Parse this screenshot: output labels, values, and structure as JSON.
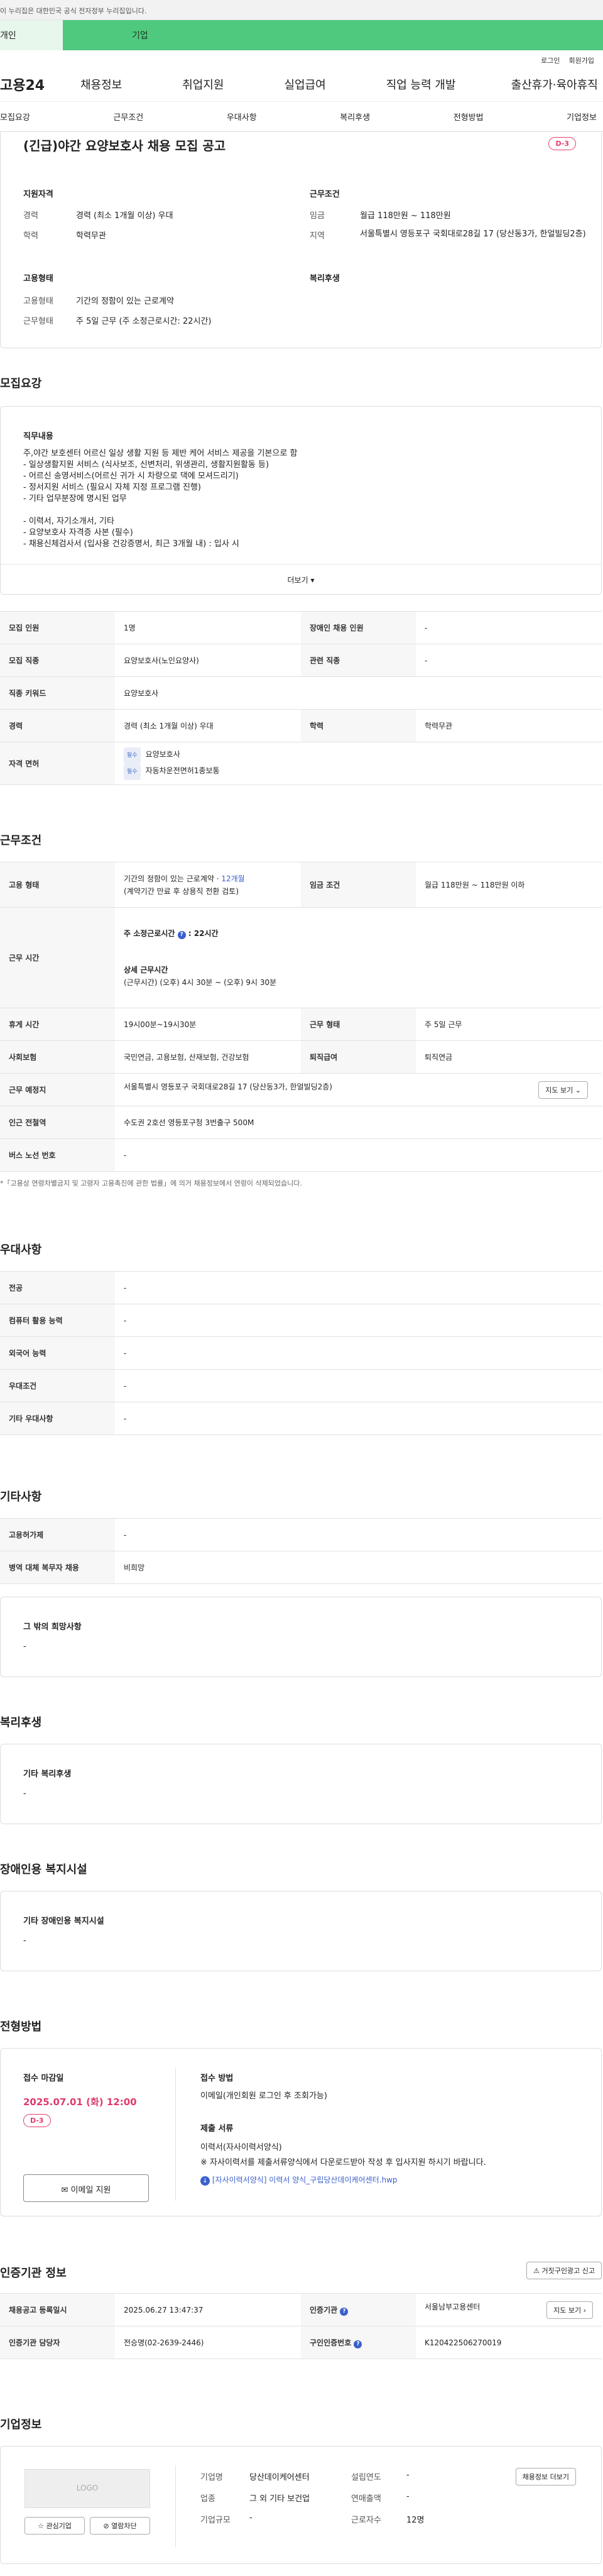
{
  "gov_bar": "이 누리집은 대한민국 공식 전자정부 누리집입니다.",
  "tabs": {
    "individual": "개인",
    "company": "기업"
  },
  "util": {
    "login": "로그인",
    "join": "회원가입"
  },
  "gnb": {
    "logo": "고용24",
    "items": [
      "채용정보",
      "취업지원",
      "실업급여",
      "직업 능력 개발",
      "출산휴가·육아휴직"
    ]
  },
  "subnav": [
    "모집요강",
    "근무조건",
    "우대사항",
    "복리후생",
    "전형방법",
    "기업정보"
  ],
  "job": {
    "title": "(긴급)야간 요양보호사 채용 모집 공고",
    "dday": "D-3",
    "qual_title": "지원자격",
    "cond_title": "근무조건",
    "type_title": "고용형태",
    "welfare_title": "복리후생",
    "qual": [
      {
        "k": "경력",
        "v": "경력 (최소 1개월 이상) 우대"
      },
      {
        "k": "학력",
        "v": "학력무관"
      }
    ],
    "cond": [
      {
        "k": "임금",
        "v": "월급 118만원 ~ 118만원"
      },
      {
        "k": "지역",
        "v": "서울특별시 영등포구 국회대로28길 17 (당산동3가, 한얼빌딩2층)"
      }
    ],
    "type": [
      {
        "k": "고용형태",
        "v": "기간의 정함이 있는 근로계약"
      },
      {
        "k": "근무형태",
        "v": "주 5일 근무 (주 소정근로시간: 22시간)"
      }
    ]
  },
  "recruit": {
    "heading": "모집요강",
    "duty_title": "직무내용",
    "duty_lines": [
      "주,야간 보호센터 어르신 일상 생활 지원 등 제반 케어 서비스 제공을 기본으로 함",
      "- 일상생활지원 서비스 (식사보조, 신변처리, 위생관리, 생활지원활동 등)",
      "- 어르신 송영서비스(어르신 귀가 시 차량으로 댁에 모셔드리기)",
      "- 정서지원 서비스 (필요시 자체 지정 프로그램 진행)",
      "- 기타 업무분장에 명시된 업무",
      "",
      "- 이력서, 자기소개서, 기타",
      "- 요양보호사 자격증 사본 (필수)",
      "- 채용신체검사서 (입사용 건강증명서, 최근 3개월 내) : 입사 시"
    ],
    "more": "더보기",
    "r1": {
      "h1": "모집 인원",
      "v1": "1명",
      "h2": "장애인 채용 인원",
      "v2": "-"
    },
    "r2": {
      "h1": "모집 직종",
      "v1": "요양보호사(노인요양사)",
      "h2": "관련 직종",
      "v2": "-"
    },
    "r3": {
      "h1": "직종 키워드",
      "v1": "요양보호사"
    },
    "r4": {
      "h1": "경력",
      "v1": "경력 (최소 1개월 이상) 우대",
      "h2": "학력",
      "v2": "학력무관"
    },
    "r5": {
      "h1": "자격 면허",
      "chip": "필수",
      "lic1": "요양보호사",
      "lic2": "자동차운전면허1종보통"
    }
  },
  "work": {
    "heading": "근무조건",
    "emp_h": "고용 형태",
    "emp_v1": "기간의 정함이 있는 근로계약 · ",
    "emp_months": "12개월",
    "emp_v2": "(계약기간 만료 후 상용직 전환 검토)",
    "wage_h": "임금 조건",
    "wage_v": "월급 118만원 ~ 118만원 이하",
    "time_h": "근무 시간",
    "time_week_label": "주 소정근로시간",
    "time_week_val": "22시간",
    "time_detail_label": "상세 근무시간",
    "time_detail_val": "(근무시간) (오후) 4시 30분 ~ (오후) 9시 30분",
    "break_h": "휴게 시간",
    "break_v": "19시00분~19시30분",
    "form_h": "근무 형태",
    "form_v": "주 5일 근무",
    "ins_h": "사회보험",
    "ins_v": "국민연금, 고용보험, 산재보험, 건강보험",
    "ret_h": "퇴직급여",
    "ret_v": "퇴직연금",
    "place_h": "근무 예정지",
    "place_v": "서울특별시 영등포구 국회대로28길 17 (당산동3가, 한얼빌딩2층)",
    "map_btn": "지도 보기",
    "sub_h": "인근 전철역",
    "sub_v": "수도권 2호선 영등포구청 3번출구 500M",
    "bus_h": "버스 노선 번호",
    "bus_v": "-",
    "note": "*「고용상 연령차별금지 및 고령자 고용촉진에 관한 법률」에 의거 채용정보에서 연령이 삭제되었습니다."
  },
  "pref": {
    "heading": "우대사항",
    "rows": [
      {
        "k": "전공",
        "v": "-"
      },
      {
        "k": "컴퓨터 활용 능력",
        "v": "-"
      },
      {
        "k": "외국어 능력",
        "v": "-"
      },
      {
        "k": "우대조건",
        "v": "-"
      },
      {
        "k": "기타 우대사항",
        "v": "-"
      }
    ]
  },
  "etc": {
    "heading": "기타사항",
    "rows": [
      {
        "k": "고용허가제",
        "v": "-"
      },
      {
        "k": "병역 대체 복무자 채용",
        "v": "비희망"
      }
    ],
    "other_title": "그 밖의 희망사항",
    "other_val": "-"
  },
  "welfare": {
    "heading": "복리후생",
    "title": "기타 복리후생",
    "val": "-"
  },
  "disabled": {
    "heading": "장애인용 복지시설",
    "title": "기타 장애인용 복지시설",
    "val": "-"
  },
  "process": {
    "heading": "전형방법",
    "deadline_title": "접수 마감일",
    "deadline": "2025.07.01 (화) 12:00",
    "dday": "D-3",
    "email_btn": "이메일 지원",
    "method_title": "접수 방법",
    "method": "이메일(개인회원 로그인 후 조회가능)",
    "docs_title": "제출 서류",
    "docs": "이력서(자사이력서양식)",
    "docs_note": "※ 자사이력서를 제출서류양식에서 다운로드받아 작성 후 입사지원 하시기 바랍니다.",
    "file": "[자사이력서양식] 이력서 양식_구립당산데이케어센터.hwp"
  },
  "agency": {
    "heading": "인증기관 정보",
    "report_btn": "거짓구인광고 신고",
    "reg_h": "채용공고 등록일시",
    "reg_v": "2025.06.27 13:47:37",
    "org_h": "인증기관",
    "org_v": "서울남부고용센터",
    "map_btn": "지도 보기",
    "mgr_h": "인증기관 담당자",
    "mgr_v": "전승명(02-2639-2446)",
    "no_h": "구인인증번호",
    "no_v": "K120422506270019"
  },
  "company": {
    "heading": "기업정보",
    "logo": "LOGO",
    "fav_btn": "관심기업",
    "block_btn": "열람차단",
    "list_btn": "채용정보 더보기",
    "name_h": "기업명",
    "name_v": "당산데이케어센터",
    "year_h": "설립연도",
    "year_v": "-",
    "ind_h": "업종",
    "ind_v": "그 외 기타 보건업",
    "sales_h": "연매출액",
    "sales_v": "-",
    "size_h": "기업규모",
    "size_v": "-",
    "emp_h": "근로자수",
    "emp_v": "12명"
  }
}
